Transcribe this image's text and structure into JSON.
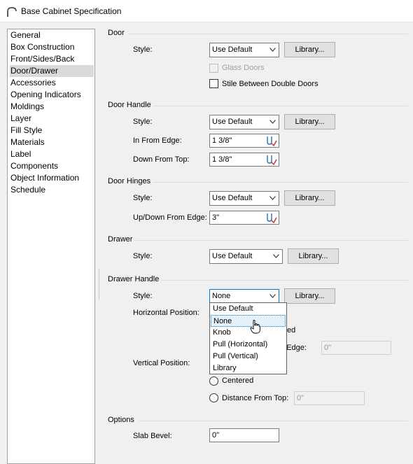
{
  "window": {
    "title": "Base Cabinet Specification"
  },
  "sidebar": {
    "items": [
      {
        "label": "General"
      },
      {
        "label": "Box Construction"
      },
      {
        "label": "Front/Sides/Back"
      },
      {
        "label": "Door/Drawer"
      },
      {
        "label": "Accessories"
      },
      {
        "label": "Opening Indicators"
      },
      {
        "label": "Moldings"
      },
      {
        "label": "Layer"
      },
      {
        "label": "Fill Style"
      },
      {
        "label": "Materials"
      },
      {
        "label": "Label"
      },
      {
        "label": "Components"
      },
      {
        "label": "Object Information"
      },
      {
        "label": "Schedule"
      }
    ],
    "selected": "Door/Drawer"
  },
  "door": {
    "title": "Door",
    "style_label": "Style:",
    "style_value": "Use Default",
    "library_label": "Library...",
    "glass_doors_label": "Glass Doors",
    "stile_label": "Stile Between Double Doors"
  },
  "door_handle": {
    "title": "Door Handle",
    "style_label": "Style:",
    "style_value": "Use Default",
    "library_label": "Library...",
    "in_from_edge_label": "In From Edge:",
    "in_from_edge_value": "1 3/8\"",
    "down_from_top_label": "Down From Top:",
    "down_from_top_value": "1 3/8\""
  },
  "door_hinges": {
    "title": "Door Hinges",
    "style_label": "Style:",
    "style_value": "Use Default",
    "library_label": "Library...",
    "updown_label": "Up/Down From Edge:",
    "updown_value": "3\""
  },
  "drawer": {
    "title": "Drawer",
    "style_label": "Style:",
    "style_value": "Use Default",
    "library_label": "Library..."
  },
  "drawer_handle": {
    "title": "Drawer Handle",
    "style_label": "Style:",
    "style_value": "None",
    "library_label": "Library...",
    "horizontal_label": "Horizontal Position:",
    "centered_partial": "ed",
    "from_edge_partial": "m Edge:",
    "from_edge_value": "0\"",
    "vertical_label": "Vertical Position:",
    "centered_label": "Centered",
    "distance_label": "Distance From Top:",
    "distance_value": "0\"",
    "dropdown_options": [
      "Use Default",
      "None",
      "Knob",
      "Pull (Horizontal)",
      "Pull (Vertical)",
      "Library"
    ],
    "dropdown_highlighted": "None"
  },
  "options": {
    "title": "Options",
    "slab_bevel_label": "Slab Bevel:",
    "slab_bevel_value": "0\""
  }
}
